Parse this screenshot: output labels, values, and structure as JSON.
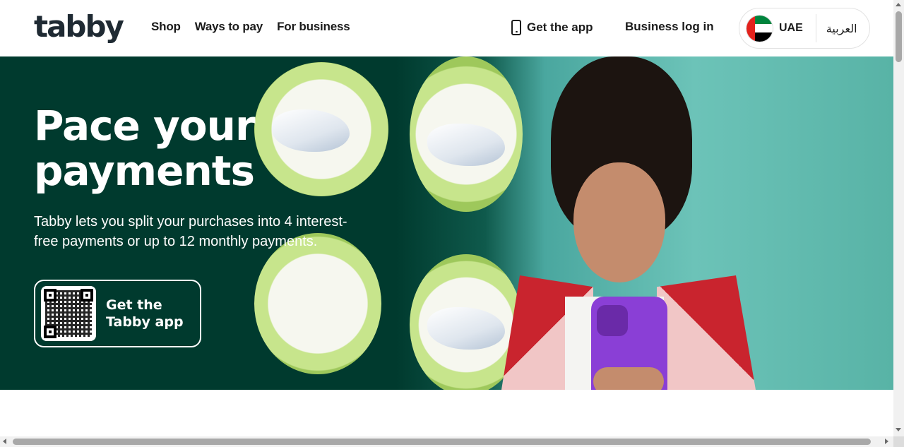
{
  "header": {
    "logo": "tabby",
    "nav": [
      {
        "label": "Shop"
      },
      {
        "label": "Ways to pay"
      },
      {
        "label": "For business"
      }
    ],
    "get_app_label": "Get the app",
    "business_login_label": "Business log in",
    "region": {
      "code": "UAE",
      "flag_icon": "uae-flag-icon"
    },
    "language_label": "العربية"
  },
  "hero": {
    "headline": "Pace your payments",
    "subtext": "Tabby lets you split your purchases into 4 interest-free payments or up to 12 monthly payments.",
    "cta_label_line1": "Get the",
    "cta_label_line2": "Tabby app",
    "background_color": "#003a2e"
  },
  "colors": {
    "brand_dark_green": "#003a2e",
    "text_dark": "#1b1b1b",
    "white": "#ffffff"
  }
}
